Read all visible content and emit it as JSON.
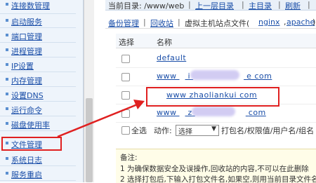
{
  "sidebar": {
    "items": [
      {
        "label": "连接数管理"
      },
      {
        "label": "启动服务"
      },
      {
        "label": "端口管理"
      },
      {
        "label": "进程管理"
      },
      {
        "label": "IP设置"
      },
      {
        "label": "内存管理"
      },
      {
        "label": "设置DNS"
      },
      {
        "label": "运行命令"
      },
      {
        "label": "磁盘使用率"
      },
      {
        "label": "文件管理"
      },
      {
        "label": "系统日志"
      },
      {
        "label": "服务重启"
      }
    ]
  },
  "path": {
    "prefix": "当前目录: /www/web",
    "up": "上一层目录",
    "root": "主目录",
    "refresh": "刷新",
    "sep": "|"
  },
  "toolbar": {
    "backup": "备份管理",
    "recycle": "回收站",
    "vhost": "虚拟主机站点文件(",
    "nginx": "nginx",
    "apache": "apache",
    "close": ")",
    "sep": "|"
  },
  "table": {
    "col_select": "选择",
    "col_name": "名称",
    "rows": [
      {
        "name": "default"
      },
      {
        "name_prefix": "www",
        "name_middle": "i",
        "name_suffix": "e com"
      },
      {
        "name": "www zhaoliankui com"
      },
      {
        "name_prefix": "www",
        "name_middle": "z",
        "name_suffix": "com"
      }
    ]
  },
  "actions": {
    "select_all": "全选",
    "action_label": "动作:",
    "select_value": "选择",
    "extra": "打包名/权限值/用户名/组名"
  },
  "notes": {
    "title": "备注:",
    "line1": "1 为确保数据安全及误操作,回收站的内容,不可以在此删除",
    "line2": "2 选择打包后,下输入打包文件名,如果空,则用当前目录文件名"
  },
  "colors": {
    "accent_red": "#e02020",
    "link": "#1a4ea8"
  }
}
